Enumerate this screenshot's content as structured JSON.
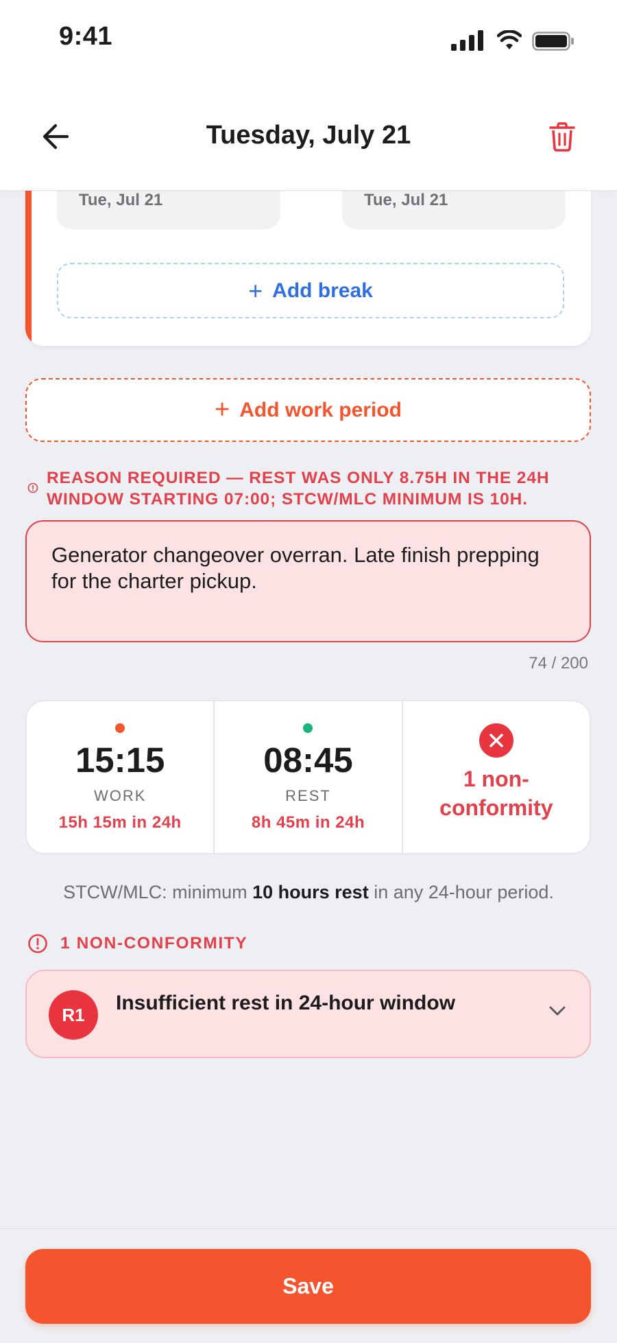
{
  "status_bar": {
    "time": "9:41"
  },
  "header": {
    "title": "Tuesday, July 21"
  },
  "period_card": {
    "start_date": "Tue, Jul 21",
    "end_date": "Tue, Jul 21",
    "add_break_label": "Add break"
  },
  "add_work_period_label": "Add work period",
  "reason": {
    "warning": "Reason required — rest was only 8.75h in the 24h window starting 07:00; STCW/MLC minimum is 10h.",
    "value": "Generator changeover overran. Late finish prepping for the charter pickup.",
    "counter": "74 / 200"
  },
  "stats": {
    "work": {
      "value": "15:15",
      "label": "WORK",
      "sub": "15h 15m in 24h"
    },
    "rest": {
      "value": "08:45",
      "label": "REST",
      "sub": "8h 45m in 24h"
    },
    "nonconformity": {
      "line1": "1 non-",
      "line2": "conformity"
    }
  },
  "rule": {
    "prefix": "STCW/MLC: minimum ",
    "bold": "10 hours rest",
    "suffix": " in any 24-hour period."
  },
  "nonconformities": {
    "header": "1 NON-CONFORMITY",
    "items": [
      {
        "code": "R1",
        "title": "Insufficient rest in 24-hour window"
      }
    ]
  },
  "save_label": "Save",
  "colors": {
    "accent": "#f4542e",
    "error": "#e2414b",
    "rest_dot": "#19b37c",
    "link_blue": "#2f6fe0"
  }
}
